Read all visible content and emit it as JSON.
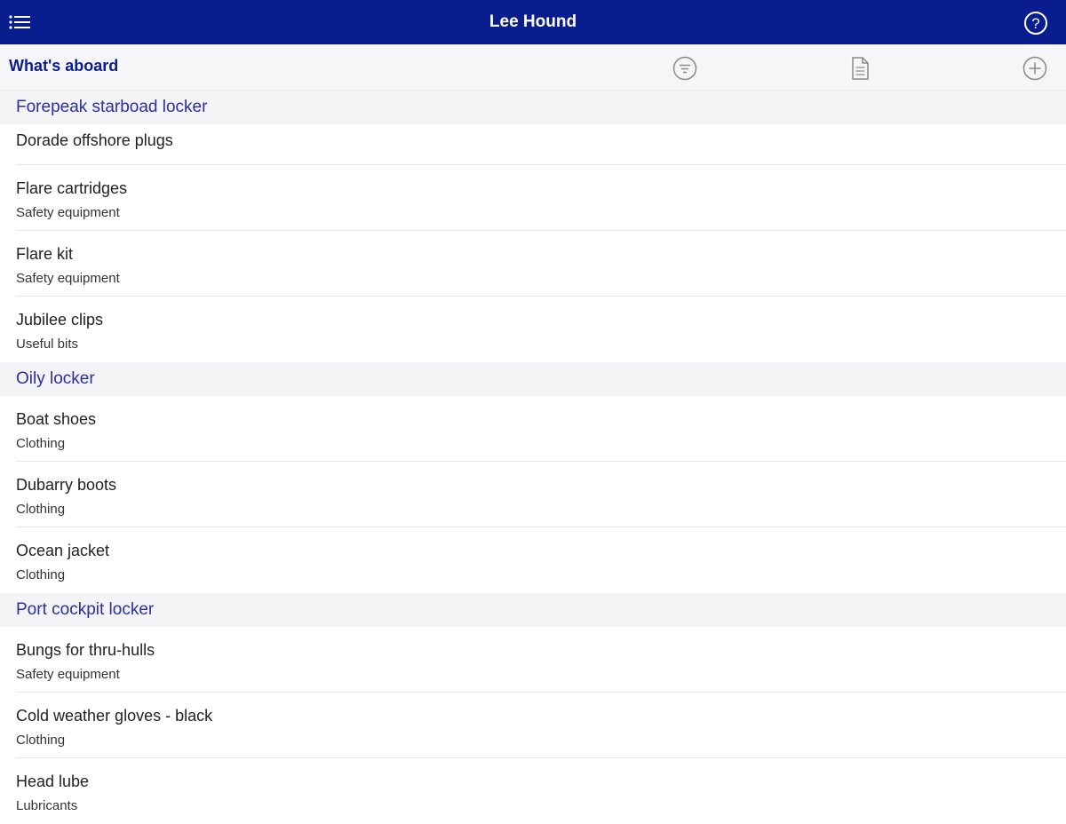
{
  "navbar": {
    "title": "Lee Hound",
    "menu_icon": "list-menu-icon",
    "help_icon": "help-circle-icon"
  },
  "toolbar": {
    "heading": "What's aboard",
    "filter_icon": "filter-icon",
    "document_icon": "document-icon",
    "add_icon": "add-circle-icon"
  },
  "colors": {
    "brand": "#0a1d8f",
    "section_text": "#2b2fa0",
    "icon": "#8a8a8a"
  },
  "sections": [
    {
      "label": "Forepeak starboad locker",
      "items": [
        {
          "name": "Dorade offshore plugs",
          "category": ""
        },
        {
          "name": "Flare cartridges",
          "category": "Safety equipment"
        },
        {
          "name": "Flare kit",
          "category": "Safety equipment"
        },
        {
          "name": "Jubilee clips",
          "category": "Useful bits"
        }
      ]
    },
    {
      "label": "Oily locker",
      "items": [
        {
          "name": "Boat shoes",
          "category": "Clothing"
        },
        {
          "name": "Dubarry boots",
          "category": "Clothing"
        },
        {
          "name": "Ocean jacket",
          "category": "Clothing"
        }
      ]
    },
    {
      "label": "Port cockpit locker",
      "items": [
        {
          "name": "Bungs for thru-hulls",
          "category": "Safety equipment"
        },
        {
          "name": "Cold weather gloves - black",
          "category": "Clothing"
        },
        {
          "name": "Head lube",
          "category": "Lubricants"
        }
      ]
    }
  ]
}
